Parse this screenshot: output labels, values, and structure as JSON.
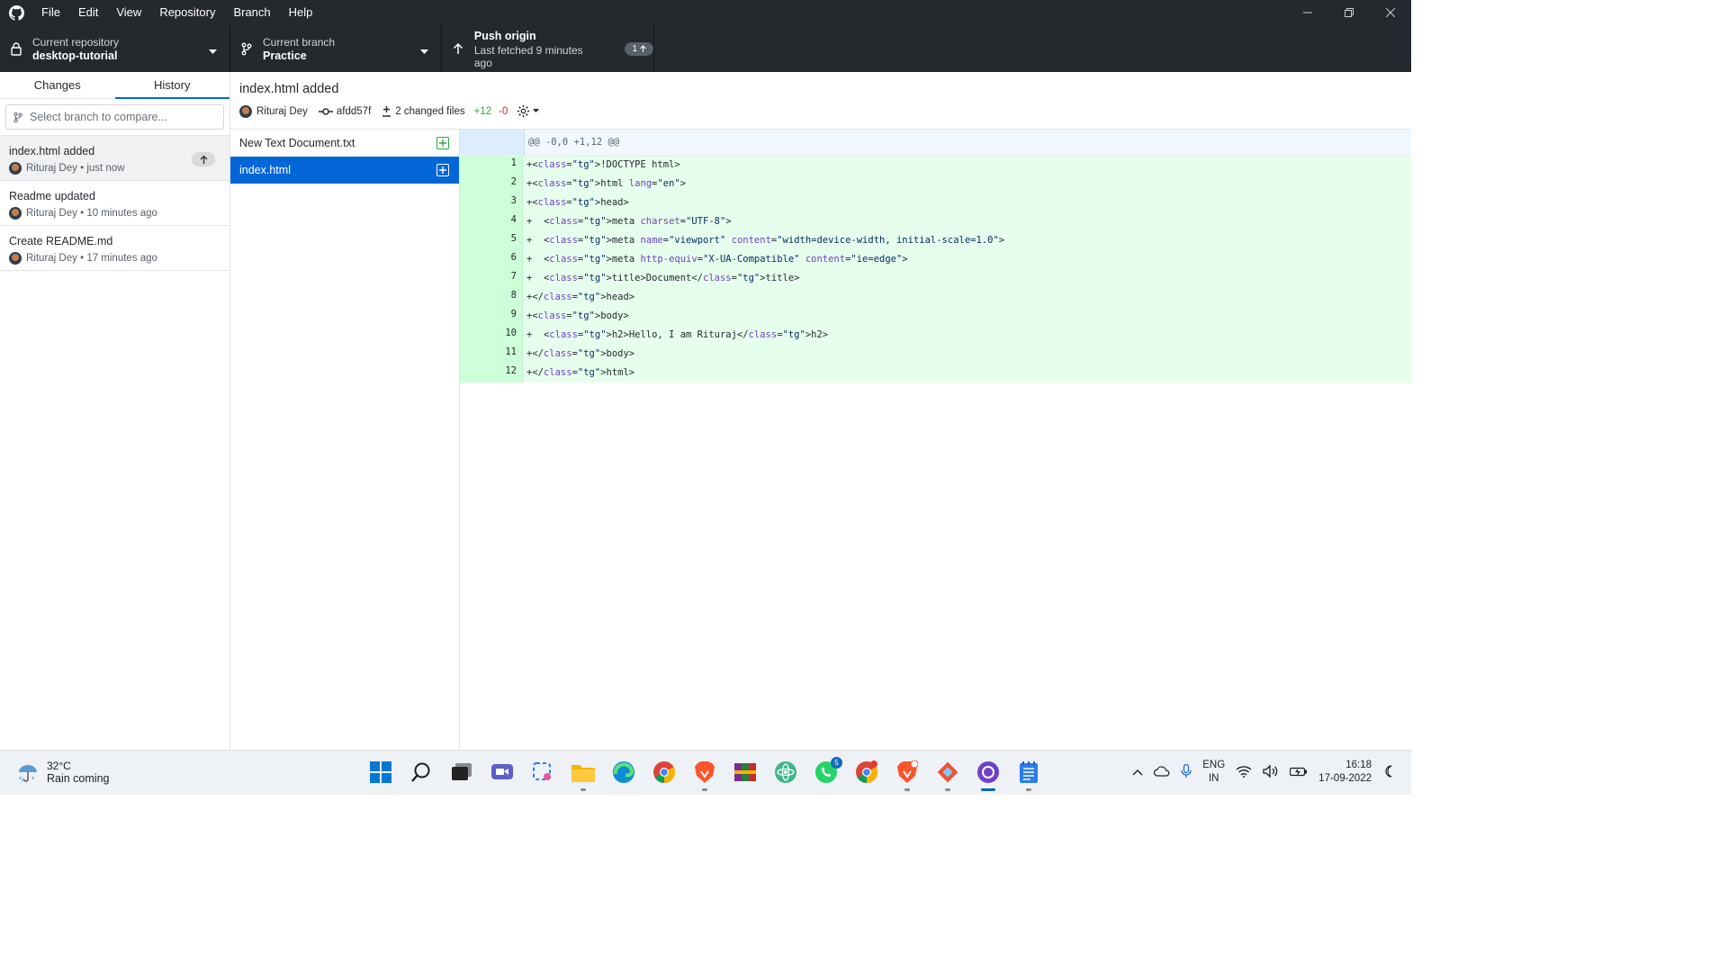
{
  "menu": [
    "File",
    "Edit",
    "View",
    "Repository",
    "Branch",
    "Help"
  ],
  "toolbar": {
    "repo_label": "Current repository",
    "repo_name": "desktop-tutorial",
    "branch_label": "Current branch",
    "branch_name": "Practice",
    "push_title": "Push origin",
    "push_subtitle": "Last fetched 9 minutes ago",
    "push_badge": "1"
  },
  "sidebar": {
    "tabs": [
      "Changes",
      "History"
    ],
    "active_tab": "History",
    "compare_placeholder": "Select branch to compare...",
    "commits": [
      {
        "summary": "index.html added",
        "author": "Rituraj Dey",
        "time": "just now",
        "unpushed": true
      },
      {
        "summary": "Readme updated",
        "author": "Rituraj Dey",
        "time": "10 minutes ago",
        "unpushed": false
      },
      {
        "summary": "Create README.md",
        "author": "Rituraj Dey",
        "time": "17 minutes ago",
        "unpushed": false
      }
    ]
  },
  "commit": {
    "title": "index.html added",
    "author": "Rituraj Dey",
    "sha": "afdd57f",
    "changed_files": "2 changed files",
    "additions": "+12",
    "deletions": "-0"
  },
  "files": [
    {
      "name": "New Text Document.txt",
      "status": "added",
      "selected": false
    },
    {
      "name": "index.html",
      "status": "added",
      "selected": true
    }
  ],
  "diff": {
    "hunk_header": "@@ -0,0 +1,12 @@",
    "lines": [
      {
        "n": "1",
        "text": "+<!DOCTYPE html>"
      },
      {
        "n": "2",
        "text": "+<html lang=\"en\">"
      },
      {
        "n": "3",
        "text": "+<head>"
      },
      {
        "n": "4",
        "text": "+  <meta charset=\"UTF-8\">"
      },
      {
        "n": "5",
        "text": "+  <meta name=\"viewport\" content=\"width=device-width, initial-scale=1.0\">"
      },
      {
        "n": "6",
        "text": "+  <meta http-equiv=\"X-UA-Compatible\" content=\"ie=edge\">"
      },
      {
        "n": "7",
        "text": "+  <title>Document</title>"
      },
      {
        "n": "8",
        "text": "+</head>"
      },
      {
        "n": "9",
        "text": "+<body>"
      },
      {
        "n": "10",
        "text": "+  <h2>Hello, I am Rituraj</h2>"
      },
      {
        "n": "11",
        "text": "+</body>"
      },
      {
        "n": "12",
        "text": "+</html>"
      }
    ]
  },
  "taskbar": {
    "weather_temp": "32°C",
    "weather_cond": "Rain coming",
    "apps": [
      "start-icon",
      "search-icon",
      "task-view-icon",
      "chat-icon",
      "snipping-tool-icon",
      "file-explorer-icon",
      "edge-icon",
      "chrome-icon",
      "brave-icon",
      "winrar-icon",
      "atom-icon",
      "whatsapp-icon",
      "chrome-profile-icon",
      "brave-beta-icon",
      "git-icon",
      "github-desktop-icon",
      "notepad-icon"
    ],
    "whatsapp_badge": "5",
    "lang_line1": "ENG",
    "lang_line2": "IN",
    "time": "16:18",
    "date": "17-09-2022"
  },
  "colors": {
    "titlebar_bg": "#24292e",
    "accent_blue": "#0366d6",
    "added_bg": "#e6ffed",
    "added_gutter": "#cdffd8",
    "additions_green": "#28a745",
    "deletions_red": "#cb2431"
  }
}
